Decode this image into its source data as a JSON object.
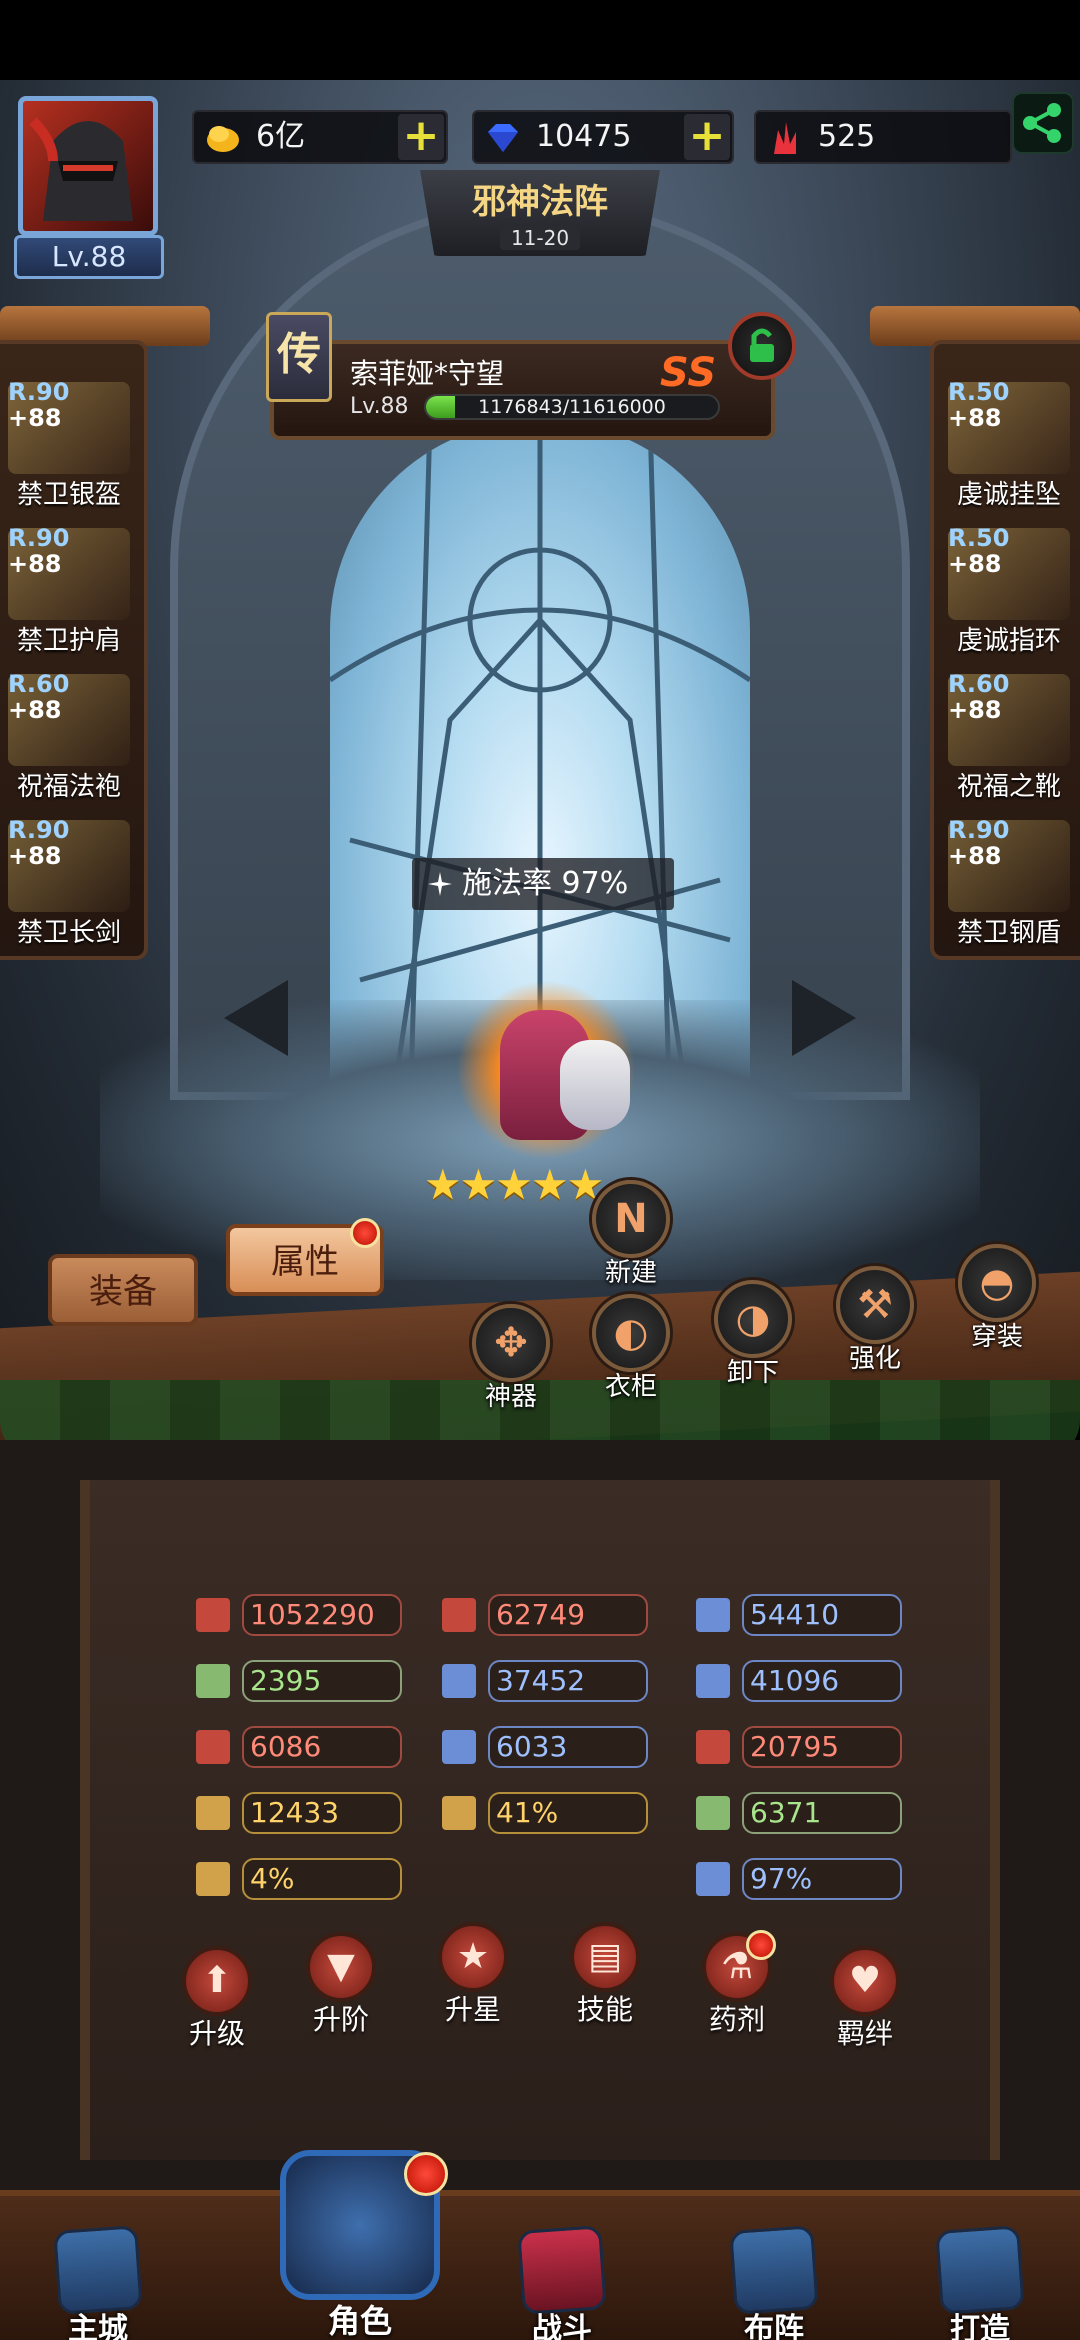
{
  "header": {
    "avatar_level": "Lv.88",
    "resources": [
      {
        "icon": "gold-coin-icon",
        "value": "6亿",
        "has_plus": true
      },
      {
        "icon": "diamond-icon",
        "value": "10475",
        "has_plus": true
      },
      {
        "icon": "crystal-icon",
        "value": "525",
        "has_plus": false
      }
    ]
  },
  "banner": {
    "title": "邪神法阵",
    "subtitle": "11-20"
  },
  "hero": {
    "badge": "传",
    "name": "索菲娅*守望",
    "rank": "SS",
    "level": "Lv.88",
    "exp_text": "1176843/11616000",
    "exp_fraction": 0.101,
    "cast_rate": "施法率 97%",
    "stars": "★★★★★"
  },
  "equipment_left": [
    {
      "rank": "R.90",
      "plus": "+88",
      "name": "禁卫银盔"
    },
    {
      "rank": "R.90",
      "plus": "+88",
      "name": "禁卫护肩"
    },
    {
      "rank": "R.60",
      "plus": "+88",
      "name": "祝福法袍"
    },
    {
      "rank": "R.90",
      "plus": "+88",
      "name": "禁卫长剑"
    }
  ],
  "equipment_right": [
    {
      "rank": "R.50",
      "plus": "+88",
      "name": "虔诚挂坠"
    },
    {
      "rank": "R.50",
      "plus": "+88",
      "name": "虔诚指环"
    },
    {
      "rank": "R.60",
      "plus": "+88",
      "name": "祝福之靴"
    },
    {
      "rank": "R.90",
      "plus": "+88",
      "name": "禁卫钢盾"
    }
  ],
  "tabs": {
    "equip": "装备",
    "attributes": "属性"
  },
  "scene_actions": {
    "new": "新建",
    "artifact": "神器",
    "wardrobe": "衣柜",
    "unequip": "卸下",
    "enhance": "强化",
    "wear": "穿装"
  },
  "stats": {
    "hp": "1052290",
    "attack": "62749",
    "defense": "54410",
    "s4": "2395",
    "s5": "37452",
    "s6": "41096",
    "s7": "6086",
    "s8": "6033",
    "s9": "20795",
    "s10": "12433",
    "s11": "41%",
    "s12": "6371",
    "s13": "4%",
    "s14": "97%"
  },
  "actions": {
    "level_up": "升级",
    "advance": "升阶",
    "star_up": "升星",
    "skill": "技能",
    "potion": "药剂",
    "bond": "羁绊"
  },
  "bottom_nav": {
    "main_city": "主城",
    "role": "角色",
    "battle": "战斗",
    "formation": "布阵",
    "forge": "打造"
  }
}
